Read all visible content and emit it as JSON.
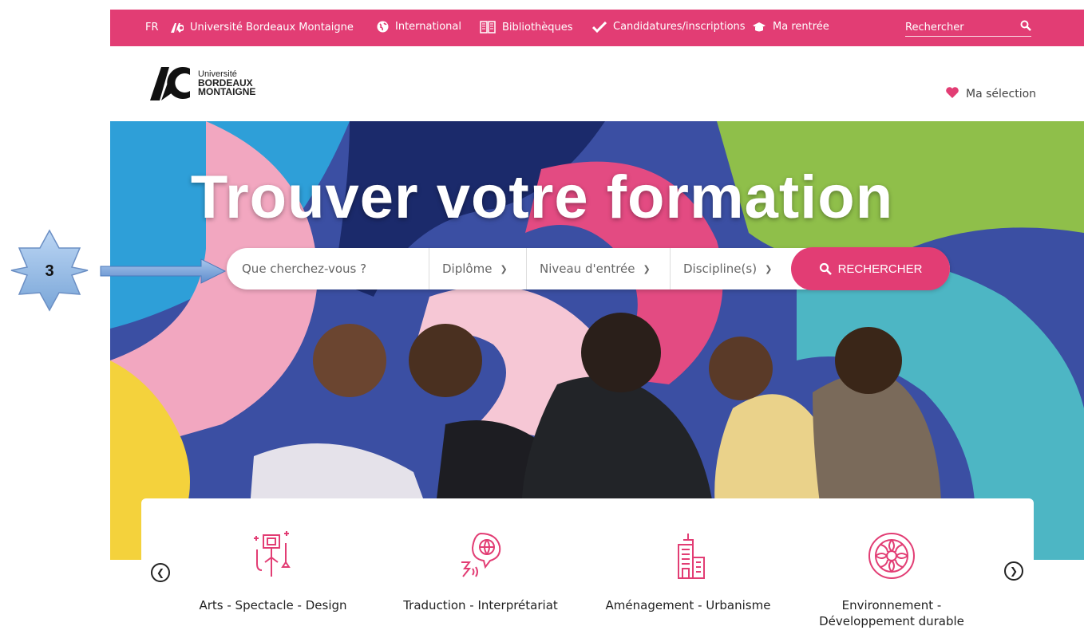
{
  "topbar": {
    "lang": "FR",
    "university": "Université Bordeaux Montaigne",
    "international": "International",
    "libraries": "Bibliothèques",
    "applications": "Candidatures/inscriptions",
    "back_to_school": "Ma rentrée",
    "search_placeholder": "Rechercher"
  },
  "logo": {
    "line1": "Université",
    "line2": "BORDEAUX",
    "line3": "MONTAIGNE"
  },
  "header": {
    "my_selection": "Ma sélection"
  },
  "hero": {
    "title": "Trouver votre formation"
  },
  "search": {
    "query_placeholder": "Que cherchez-vous ?",
    "diploma": "Diplôme",
    "entry_level": "Niveau d'entrée",
    "disciplines": "Discipline(s)",
    "button": "RECHERCHER"
  },
  "annotation": {
    "step": "3"
  },
  "categories": [
    {
      "label": "Arts - Spectacle - Design",
      "icon": "arts-palette-icon"
    },
    {
      "label": "Traduction - Interprétariat",
      "icon": "translation-globe-icon"
    },
    {
      "label": "Aménagement - Urbanisme",
      "icon": "buildings-icon"
    },
    {
      "label": "Environnement - Développement durable",
      "icon": "environment-globe-icon"
    }
  ],
  "colors": {
    "brand": "#e23d74",
    "text": "#222222"
  }
}
